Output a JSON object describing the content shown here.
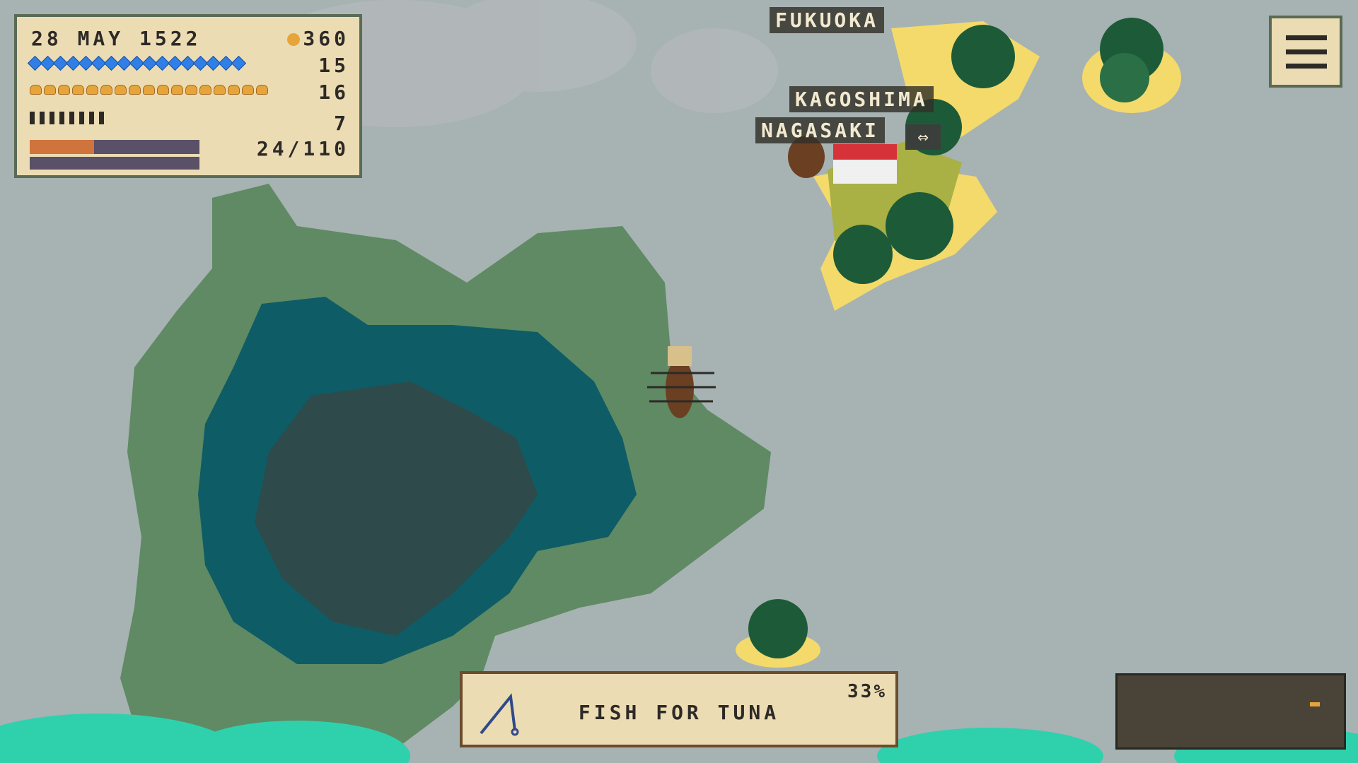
{
  "hud": {
    "date": "28 MAY 1522",
    "gold": "360",
    "water": "15",
    "food": "16",
    "crew": "7",
    "cargo": "24/110",
    "water_icons": 17,
    "food_icons": 17,
    "crew_icons": 8,
    "health_fraction": 0.38
  },
  "cities": [
    "FUKUOKA",
    "KAGOSHIMA",
    "NAGASAKI"
  ],
  "action": {
    "label": "FISH FOR TUNA",
    "progress": "33%"
  },
  "icons": {
    "menu": "hamburger-menu-icon",
    "rod": "fishing-rod-icon",
    "gold": "gold-coin-icon",
    "swap": "swap-arrows-icon"
  },
  "colors": {
    "sea": "#a7b2b3",
    "shallow": "#5f8a63",
    "deep": "#0e5c66",
    "abyss": "#2f4a4a",
    "panel": "#ecdcb4",
    "sand": "#f4da6a"
  }
}
